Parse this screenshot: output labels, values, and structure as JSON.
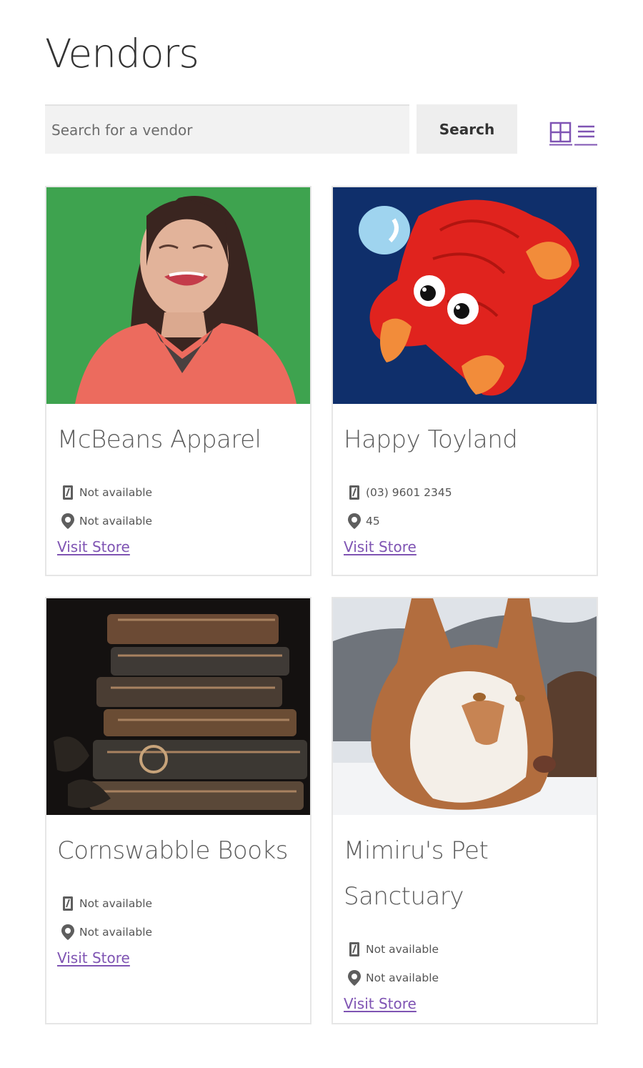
{
  "page": {
    "title": "Vendors"
  },
  "search": {
    "placeholder": "Search for a vendor",
    "button_label": "Search"
  },
  "view_toggle": {
    "grid_icon": "grid-view-icon",
    "list_icon": "list-view-icon",
    "accent": "#7f54b3"
  },
  "vendors": [
    {
      "name": "McBeans Apparel",
      "phone": "Not available",
      "address": "Not available",
      "link": "Visit Store"
    },
    {
      "name": "Happy Toyland",
      "phone": "(03) 9601 2345",
      "address": "45",
      "link": "Visit Store"
    },
    {
      "name": "Cornswabble Books",
      "phone": "Not available",
      "address": "Not available",
      "link": "Visit Store"
    },
    {
      "name": "Mimiru's Pet Sanctuary",
      "phone": "Not available",
      "address": "Not available",
      "link": "Visit Store"
    }
  ],
  "icons": {
    "phone": "phone-icon",
    "location": "map-pin-icon"
  },
  "colors": {
    "link": "#7f54b3",
    "card_border": "#e6e6e6",
    "input_bg": "#f2f2f2"
  }
}
